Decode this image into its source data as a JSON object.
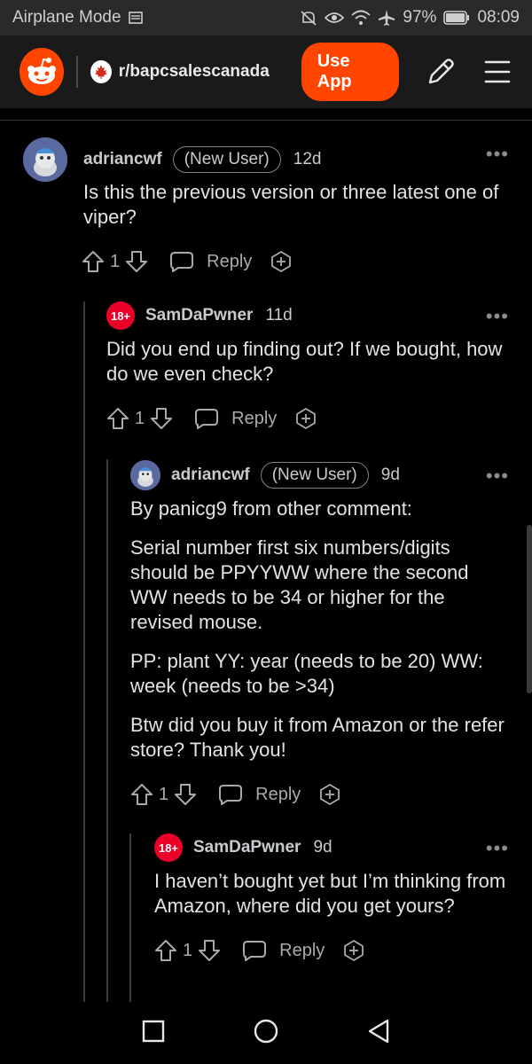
{
  "status_bar": {
    "mode_label": "Airplane Mode",
    "battery": "97%",
    "time": "08:09"
  },
  "header": {
    "subreddit": "r/bapcsalescanada",
    "use_app_label": "Use App"
  },
  "comments": [
    {
      "username": "adriancwf",
      "flair": "(New User)",
      "age": "12d",
      "more": "•••",
      "paragraphs": [
        "Is this the previous version or three latest one of viper?"
      ],
      "score": "1",
      "reply_label": "Reply"
    },
    {
      "badge": "18+",
      "username": "SamDaPwner",
      "age": "11d",
      "more": "•••",
      "paragraphs": [
        "Did you end up finding out? If we bought, how do we even check?"
      ],
      "score": "1",
      "reply_label": "Reply"
    },
    {
      "username": "adriancwf",
      "flair": "(New User)",
      "age": "9d",
      "more": "•••",
      "paragraphs": [
        "By panicg9 from other comment:",
        "Serial number first six numbers/digits should be PPYYWW where the second WW needs to be 34 or higher for the revised mouse.",
        "PP: plant YY: year (needs to be 20) WW: week (needs to be >34)",
        "Btw did you buy it from Amazon or the refer store? Thank you!"
      ],
      "score": "1",
      "reply_label": "Reply"
    },
    {
      "badge": "18+",
      "username": "SamDaPwner",
      "age": "9d",
      "more": "•••",
      "paragraphs": [
        "I haven’t bought yet but I’m thinking from Amazon, where did you get yours?"
      ],
      "score": "1",
      "reply_label": "Reply"
    }
  ],
  "icons": {
    "upvote": "arrow-up-outline",
    "downvote": "arrow-down-outline",
    "reply": "speech-bubble",
    "award": "hexagon-plus",
    "more": "ellipsis"
  },
  "colors": {
    "brand": "#ff4500",
    "nsfw_badge": "#ea0027",
    "background": "#000000",
    "header_bg": "#1a1a1b"
  }
}
